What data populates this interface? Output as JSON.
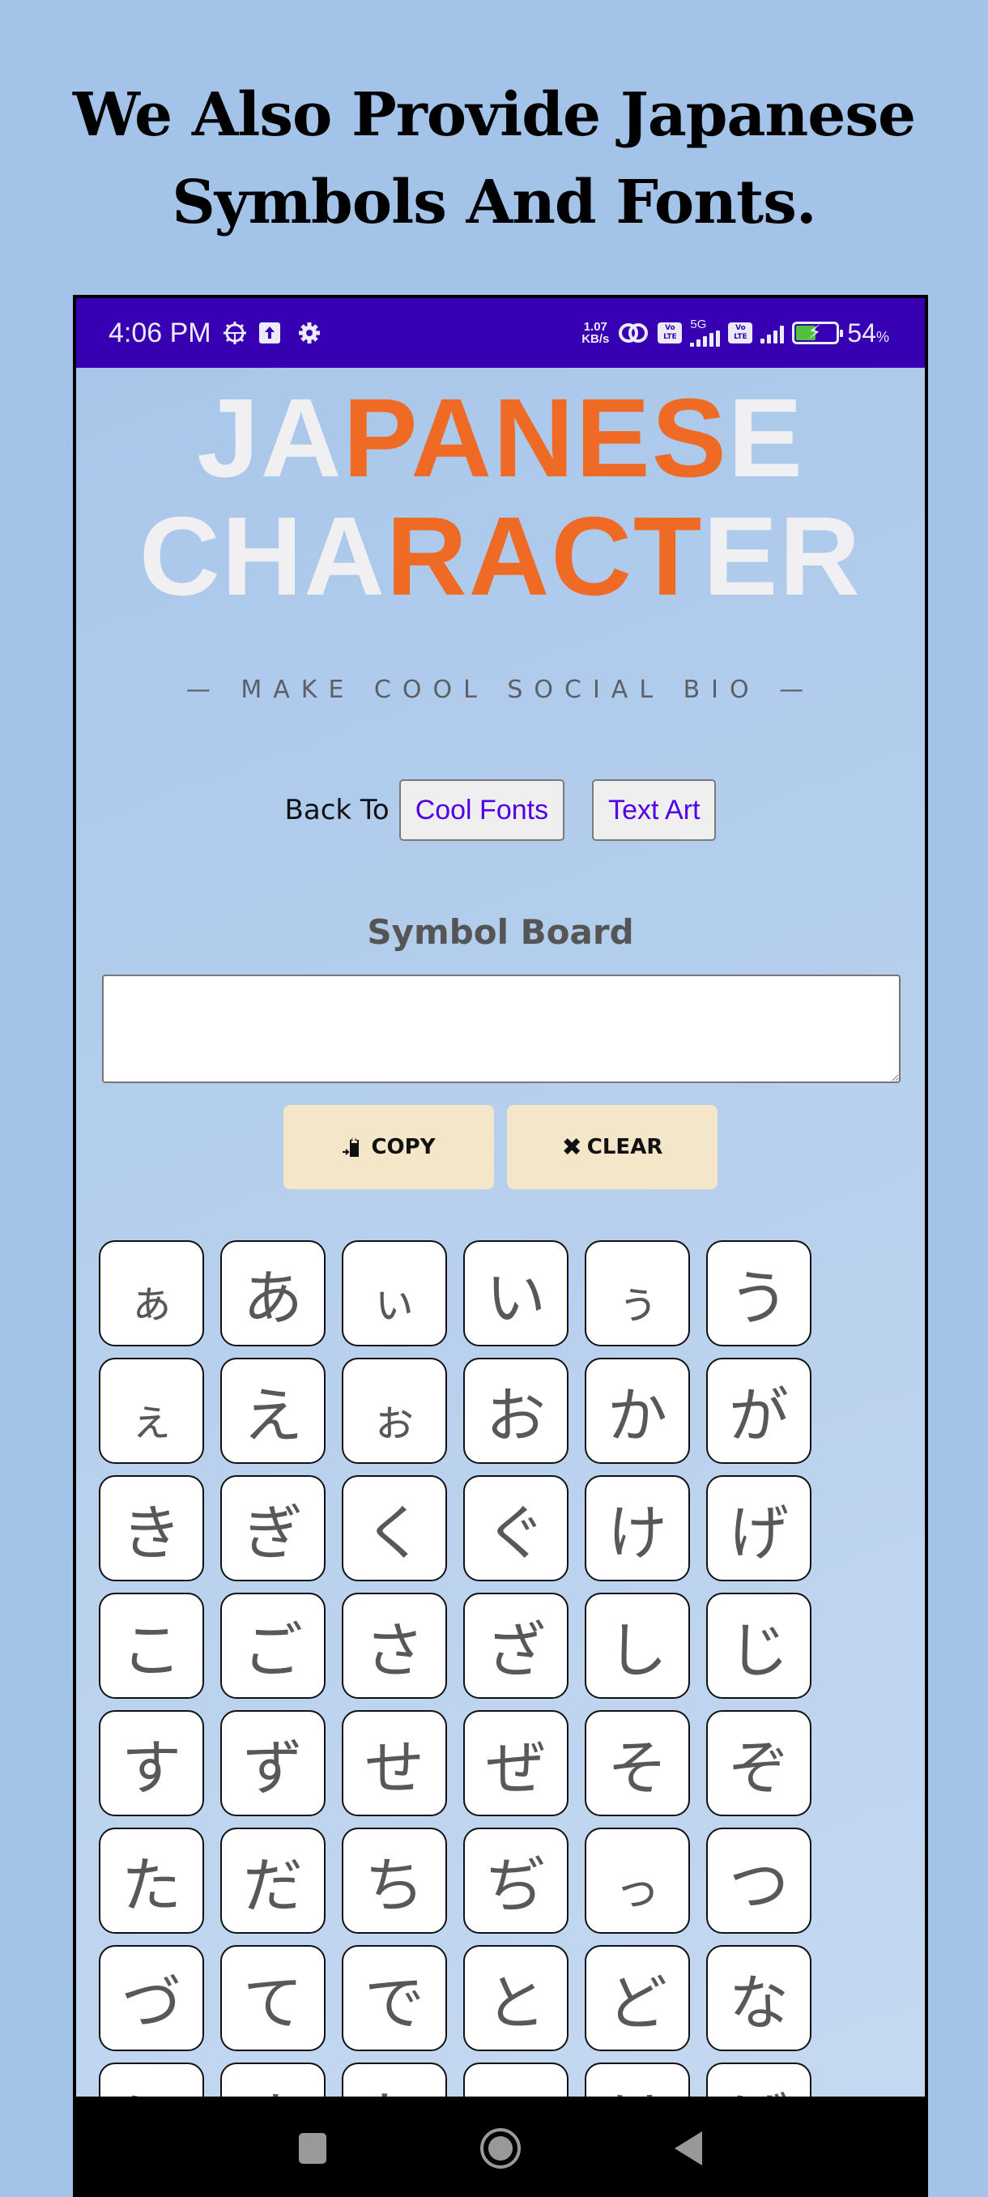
{
  "promo": {
    "heading_line1": "We Also Provide Japanese",
    "heading_line2": "Symbols And Fonts."
  },
  "status_bar": {
    "time": "4:06 PM",
    "left_icons": [
      "android-debug-icon",
      "upload-icon",
      "settings-icon"
    ],
    "net_speed_value": "1.07",
    "net_speed_unit": "KB/s",
    "network": "5G",
    "volte_label": "Vo LTE",
    "battery_percent": "54",
    "battery_level": 0.54,
    "battery_charging": true,
    "colors": {
      "bar": "#3700b3",
      "battery_fill": "#4fc13a"
    }
  },
  "logo": {
    "line1": "JAPANESE",
    "line2": "CHARACTER",
    "colors": {
      "base": "#f0f0f2",
      "accent": "#ef6a24"
    }
  },
  "tagline": "— MAKE COOL SOCIAL BIO —",
  "back_to": {
    "label": "Back To",
    "links": [
      {
        "label": "Cool Fonts"
      },
      {
        "label": "Text Art"
      }
    ],
    "link_color": "#5100e5"
  },
  "symbol_board": {
    "title": "Symbol Board",
    "input_value": "",
    "copy_icon": "✍",
    "copy_label": "COPY",
    "clear_icon": "✖",
    "clear_label": "CLEAR",
    "button_color": "#f4e6c8"
  },
  "characters": [
    {
      "char": "ぁ",
      "small": true
    },
    {
      "char": "あ"
    },
    {
      "char": "ぃ",
      "small": true
    },
    {
      "char": "い"
    },
    {
      "char": "ぅ",
      "small": true
    },
    {
      "char": "う"
    },
    {
      "char": "ぇ",
      "small": true
    },
    {
      "char": "え"
    },
    {
      "char": "ぉ",
      "small": true
    },
    {
      "char": "お"
    },
    {
      "char": "か"
    },
    {
      "char": "が"
    },
    {
      "char": "き"
    },
    {
      "char": "ぎ"
    },
    {
      "char": "く"
    },
    {
      "char": "ぐ"
    },
    {
      "char": "け"
    },
    {
      "char": "げ"
    },
    {
      "char": "こ"
    },
    {
      "char": "ご"
    },
    {
      "char": "さ"
    },
    {
      "char": "ざ"
    },
    {
      "char": "し"
    },
    {
      "char": "じ"
    },
    {
      "char": "す"
    },
    {
      "char": "ず"
    },
    {
      "char": "せ"
    },
    {
      "char": "ぜ"
    },
    {
      "char": "そ"
    },
    {
      "char": "ぞ"
    },
    {
      "char": "た"
    },
    {
      "char": "だ"
    },
    {
      "char": "ち"
    },
    {
      "char": "ぢ"
    },
    {
      "char": "っ",
      "small": true
    },
    {
      "char": "つ"
    },
    {
      "char": "づ"
    },
    {
      "char": "て"
    },
    {
      "char": "で"
    },
    {
      "char": "と"
    },
    {
      "char": "ど"
    },
    {
      "char": "な"
    },
    {
      "char": "に"
    },
    {
      "char": "ぬ"
    },
    {
      "char": "ね"
    },
    {
      "char": "の"
    },
    {
      "char": "は"
    },
    {
      "char": "ば"
    }
  ],
  "nav_bar": {
    "buttons": [
      "recent-apps",
      "home",
      "back"
    ]
  }
}
